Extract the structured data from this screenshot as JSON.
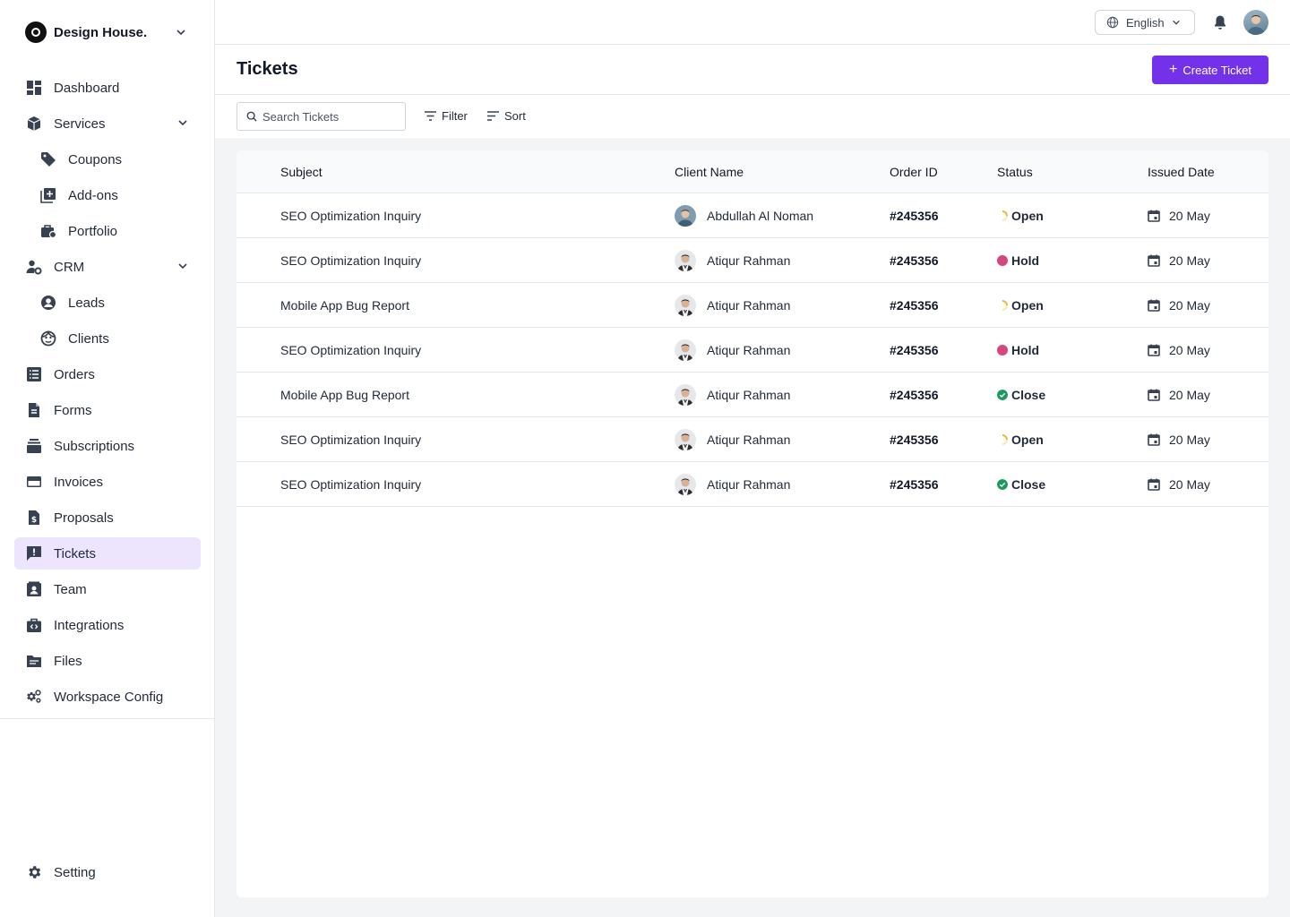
{
  "brand": {
    "name": "Design House."
  },
  "nav": [
    {
      "key": "dashboard",
      "label": "Dashboard",
      "icon": "dashboard-icon"
    },
    {
      "key": "services",
      "label": "Services",
      "icon": "box-icon",
      "expand": true
    },
    {
      "key": "coupons",
      "label": "Coupons",
      "icon": "tag-icon",
      "sub": true
    },
    {
      "key": "addons",
      "label": "Add-ons",
      "icon": "add-box-icon",
      "sub": true
    },
    {
      "key": "portfolio",
      "label": "Portfolio",
      "icon": "briefcase-icon",
      "sub": true
    },
    {
      "key": "crm",
      "label": "CRM",
      "icon": "user-gear-icon",
      "expand": true
    },
    {
      "key": "leads",
      "label": "Leads",
      "icon": "account-circle-icon",
      "sub": true
    },
    {
      "key": "clients",
      "label": "Clients",
      "icon": "face-icon",
      "sub": true
    },
    {
      "key": "orders",
      "label": "Orders",
      "icon": "list-icon"
    },
    {
      "key": "forms",
      "label": "Forms",
      "icon": "document-icon"
    },
    {
      "key": "subscriptions",
      "label": "Subscriptions",
      "icon": "stack-icon"
    },
    {
      "key": "invoices",
      "label": "Invoices",
      "icon": "card-icon"
    },
    {
      "key": "proposals",
      "label": "Proposals",
      "icon": "dollar-document-icon"
    },
    {
      "key": "tickets",
      "label": "Tickets",
      "icon": "feedback-icon",
      "active": true
    },
    {
      "key": "team",
      "label": "Team",
      "icon": "contact-card-icon"
    },
    {
      "key": "integrations",
      "label": "Integrations",
      "icon": "code-briefcase-icon"
    },
    {
      "key": "files",
      "label": "Files",
      "icon": "folder-icon"
    },
    {
      "key": "workspace",
      "label": "Workspace Config",
      "icon": "gears-icon"
    }
  ],
  "setting": {
    "label": "Setting"
  },
  "topbar": {
    "language": "English"
  },
  "page": {
    "title": "Tickets",
    "create_label": "Create Ticket"
  },
  "toolbar": {
    "search_placeholder": "Search Tickets",
    "filter_label": "Filter",
    "sort_label": "Sort"
  },
  "table": {
    "headers": {
      "subject": "Subject",
      "client": "Client Name",
      "order": "Order ID",
      "status": "Status",
      "date": "Issued Date"
    },
    "rows": [
      {
        "subject": "SEO Optimization Inquiry",
        "client": "Abdullah Al Noman",
        "order": "#245356",
        "status": "Open",
        "date": "20 May"
      },
      {
        "subject": "SEO Optimization Inquiry",
        "client": "Atiqur Rahman",
        "order": "#245356",
        "status": "Hold",
        "date": "20 May"
      },
      {
        "subject": "Mobile App Bug Report",
        "client": "Atiqur Rahman",
        "order": "#245356",
        "status": "Open",
        "date": "20 May"
      },
      {
        "subject": "SEO Optimization Inquiry",
        "client": "Atiqur Rahman",
        "order": "#245356",
        "status": "Hold",
        "date": "20 May"
      },
      {
        "subject": "Mobile App Bug Report",
        "client": "Atiqur Rahman",
        "order": "#245356",
        "status": "Close",
        "date": "20 May"
      },
      {
        "subject": "SEO Optimization Inquiry",
        "client": "Atiqur Rahman",
        "order": "#245356",
        "status": "Open",
        "date": "20 May"
      },
      {
        "subject": "SEO Optimization Inquiry",
        "client": "Atiqur Rahman",
        "order": "#245356",
        "status": "Close",
        "date": "20 May"
      }
    ]
  },
  "colors": {
    "accent": "#7332ea",
    "active_bg": "#ede4fd",
    "hold": "#d6457f",
    "close": "#1a9a5c",
    "open": "#f0b429"
  }
}
